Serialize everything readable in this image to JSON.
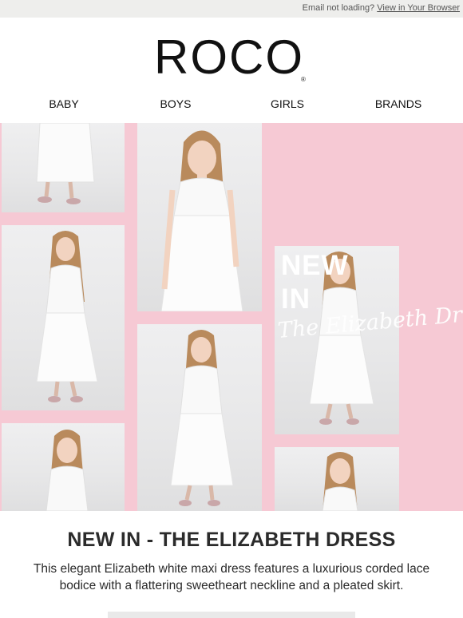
{
  "topbar": {
    "notice": "Email not loading?",
    "link": "View in Your Browser"
  },
  "logo": {
    "text": "ROCO",
    "reg": "®"
  },
  "nav": {
    "items": [
      "BABY",
      "BOYS",
      "GIRLS",
      "BRANDS"
    ]
  },
  "hero": {
    "title_line1": "NEW",
    "title_line2": "IN",
    "script": "The Elizabeth Dress",
    "background_color": "#f6c9d4"
  },
  "content": {
    "headline": "NEW IN - THE ELIZABETH DRESS",
    "description": "This elegant Elizabeth white maxi dress features a luxurious corded lace bodice with a flattering sweetheart neckline and a pleated skirt."
  }
}
